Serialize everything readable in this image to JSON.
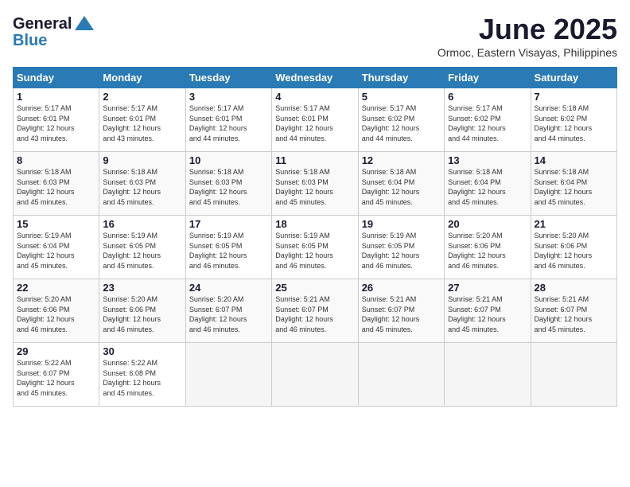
{
  "header": {
    "logo_line1": "General",
    "logo_line2": "Blue",
    "title": "June 2025",
    "subtitle": "Ormoc, Eastern Visayas, Philippines"
  },
  "weekdays": [
    "Sunday",
    "Monday",
    "Tuesday",
    "Wednesday",
    "Thursday",
    "Friday",
    "Saturday"
  ],
  "weeks": [
    [
      {
        "day": "1",
        "info": "Sunrise: 5:17 AM\nSunset: 6:01 PM\nDaylight: 12 hours\nand 43 minutes."
      },
      {
        "day": "2",
        "info": "Sunrise: 5:17 AM\nSunset: 6:01 PM\nDaylight: 12 hours\nand 43 minutes."
      },
      {
        "day": "3",
        "info": "Sunrise: 5:17 AM\nSunset: 6:01 PM\nDaylight: 12 hours\nand 44 minutes."
      },
      {
        "day": "4",
        "info": "Sunrise: 5:17 AM\nSunset: 6:01 PM\nDaylight: 12 hours\nand 44 minutes."
      },
      {
        "day": "5",
        "info": "Sunrise: 5:17 AM\nSunset: 6:02 PM\nDaylight: 12 hours\nand 44 minutes."
      },
      {
        "day": "6",
        "info": "Sunrise: 5:17 AM\nSunset: 6:02 PM\nDaylight: 12 hours\nand 44 minutes."
      },
      {
        "day": "7",
        "info": "Sunrise: 5:18 AM\nSunset: 6:02 PM\nDaylight: 12 hours\nand 44 minutes."
      }
    ],
    [
      {
        "day": "8",
        "info": "Sunrise: 5:18 AM\nSunset: 6:03 PM\nDaylight: 12 hours\nand 45 minutes."
      },
      {
        "day": "9",
        "info": "Sunrise: 5:18 AM\nSunset: 6:03 PM\nDaylight: 12 hours\nand 45 minutes."
      },
      {
        "day": "10",
        "info": "Sunrise: 5:18 AM\nSunset: 6:03 PM\nDaylight: 12 hours\nand 45 minutes."
      },
      {
        "day": "11",
        "info": "Sunrise: 5:18 AM\nSunset: 6:03 PM\nDaylight: 12 hours\nand 45 minutes."
      },
      {
        "day": "12",
        "info": "Sunrise: 5:18 AM\nSunset: 6:04 PM\nDaylight: 12 hours\nand 45 minutes."
      },
      {
        "day": "13",
        "info": "Sunrise: 5:18 AM\nSunset: 6:04 PM\nDaylight: 12 hours\nand 45 minutes."
      },
      {
        "day": "14",
        "info": "Sunrise: 5:18 AM\nSunset: 6:04 PM\nDaylight: 12 hours\nand 45 minutes."
      }
    ],
    [
      {
        "day": "15",
        "info": "Sunrise: 5:19 AM\nSunset: 6:04 PM\nDaylight: 12 hours\nand 45 minutes."
      },
      {
        "day": "16",
        "info": "Sunrise: 5:19 AM\nSunset: 6:05 PM\nDaylight: 12 hours\nand 45 minutes."
      },
      {
        "day": "17",
        "info": "Sunrise: 5:19 AM\nSunset: 6:05 PM\nDaylight: 12 hours\nand 46 minutes."
      },
      {
        "day": "18",
        "info": "Sunrise: 5:19 AM\nSunset: 6:05 PM\nDaylight: 12 hours\nand 46 minutes."
      },
      {
        "day": "19",
        "info": "Sunrise: 5:19 AM\nSunset: 6:05 PM\nDaylight: 12 hours\nand 46 minutes."
      },
      {
        "day": "20",
        "info": "Sunrise: 5:20 AM\nSunset: 6:06 PM\nDaylight: 12 hours\nand 46 minutes."
      },
      {
        "day": "21",
        "info": "Sunrise: 5:20 AM\nSunset: 6:06 PM\nDaylight: 12 hours\nand 46 minutes."
      }
    ],
    [
      {
        "day": "22",
        "info": "Sunrise: 5:20 AM\nSunset: 6:06 PM\nDaylight: 12 hours\nand 46 minutes."
      },
      {
        "day": "23",
        "info": "Sunrise: 5:20 AM\nSunset: 6:06 PM\nDaylight: 12 hours\nand 46 minutes."
      },
      {
        "day": "24",
        "info": "Sunrise: 5:20 AM\nSunset: 6:07 PM\nDaylight: 12 hours\nand 46 minutes."
      },
      {
        "day": "25",
        "info": "Sunrise: 5:21 AM\nSunset: 6:07 PM\nDaylight: 12 hours\nand 46 minutes."
      },
      {
        "day": "26",
        "info": "Sunrise: 5:21 AM\nSunset: 6:07 PM\nDaylight: 12 hours\nand 45 minutes."
      },
      {
        "day": "27",
        "info": "Sunrise: 5:21 AM\nSunset: 6:07 PM\nDaylight: 12 hours\nand 45 minutes."
      },
      {
        "day": "28",
        "info": "Sunrise: 5:21 AM\nSunset: 6:07 PM\nDaylight: 12 hours\nand 45 minutes."
      }
    ],
    [
      {
        "day": "29",
        "info": "Sunrise: 5:22 AM\nSunset: 6:07 PM\nDaylight: 12 hours\nand 45 minutes."
      },
      {
        "day": "30",
        "info": "Sunrise: 5:22 AM\nSunset: 6:08 PM\nDaylight: 12 hours\nand 45 minutes."
      },
      {
        "day": "",
        "info": ""
      },
      {
        "day": "",
        "info": ""
      },
      {
        "day": "",
        "info": ""
      },
      {
        "day": "",
        "info": ""
      },
      {
        "day": "",
        "info": ""
      }
    ]
  ]
}
